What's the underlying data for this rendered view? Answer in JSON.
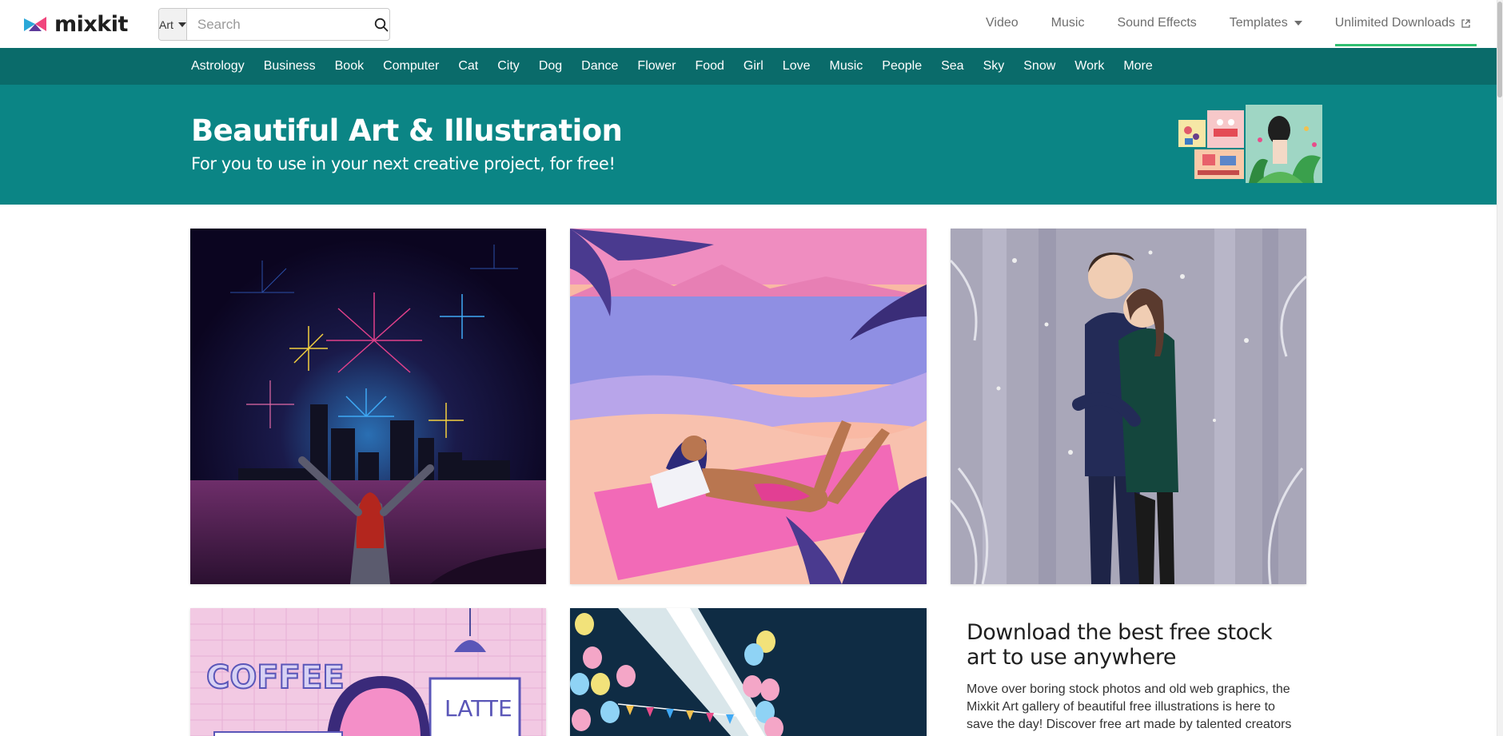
{
  "header": {
    "logo_text": "mixkit",
    "search": {
      "category": "Art",
      "placeholder": "Search"
    },
    "nav": [
      {
        "label": "Video"
      },
      {
        "label": "Music"
      },
      {
        "label": "Sound Effects"
      },
      {
        "label": "Templates"
      },
      {
        "label": "Unlimited Downloads"
      }
    ]
  },
  "categories": [
    "Astrology",
    "Business",
    "Book",
    "Computer",
    "Cat",
    "City",
    "Dog",
    "Dance",
    "Flower",
    "Food",
    "Girl",
    "Love",
    "Music",
    "People",
    "Sea",
    "Sky",
    "Snow",
    "Work",
    "More"
  ],
  "hero": {
    "title": "Beautiful Art & Illustration",
    "subtitle": "For you to use in your next creative project, for free!"
  },
  "gallery": {
    "coffee_sign": "COFFEE",
    "latte_sign": "LATTE"
  },
  "promo": {
    "title": "Download the best free stock art to use anywhere",
    "body": "Move over boring stock photos and old web graphics, the Mixkit Art gallery of beautiful free illustrations is here to save the day! Discover free art made by talented creators"
  },
  "colors": {
    "category_bar": "#0a6b6a",
    "hero_bg": "#0b8585",
    "active_underline": "#2fbf71"
  },
  "icons": [
    "mixkit-logo",
    "search-icon",
    "caret-down-icon",
    "external-link-icon"
  ]
}
